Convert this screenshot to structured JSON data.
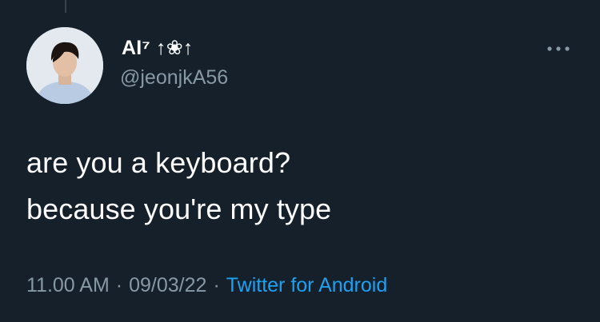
{
  "tweet": {
    "display_name": "AI⁷ ↑❀↑",
    "handle": "@jeonjkA56",
    "text_lines": [
      "are you a keyboard?",
      "because you're my type"
    ],
    "time": "11.00 AM",
    "date": "09/03/22",
    "separator": "·",
    "source": "Twitter for Android"
  },
  "icons": {
    "more": "more-dots-icon",
    "avatar": "profile-avatar"
  },
  "colors": {
    "background": "#15202b",
    "primary_text": "#ffffff",
    "secondary_text": "#8899a6",
    "link": "#1da1f2"
  }
}
